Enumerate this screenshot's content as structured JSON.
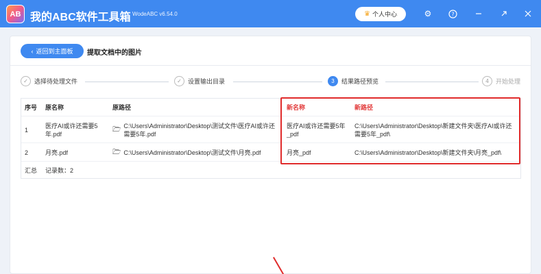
{
  "app": {
    "logo_text": "AB",
    "title": "我的ABC软件工具箱",
    "version": "WodeABC v6.54.0",
    "user_center": "个人中心"
  },
  "icons": {
    "crown": "crown-icon",
    "settings": "gear-icon",
    "help": "help-icon",
    "minimize": "minimize-icon",
    "maximize": "maximize-icon",
    "close": "close-icon",
    "back": "chevron-left-icon",
    "folder": "folder-icon"
  },
  "nav": {
    "back_label": "返回到主面板",
    "page_title": "提取文档中的图片"
  },
  "steps": [
    {
      "label": "选择待处理文件",
      "marker": "✓",
      "state": "done"
    },
    {
      "label": "设置输出目录",
      "marker": "✓",
      "state": "done"
    },
    {
      "label": "结果路径预览",
      "marker": "3",
      "state": "active"
    },
    {
      "label": "开始处理",
      "marker": "4",
      "state": "pending"
    }
  ],
  "table": {
    "headers": {
      "index": "序号",
      "orig_name": "原名称",
      "orig_path": "原路径",
      "new_name": "新名称",
      "new_path": "新路径"
    },
    "rows": [
      {
        "index": "1",
        "orig_name": "医疗AI或许还需要5年.pdf",
        "orig_path": "C:\\Users\\Administrator\\Desktop\\测试文件\\医疗AI或许还需要5年.pdf",
        "new_name": "医疗AI或许还需要5年_pdf",
        "new_path": "C:\\Users\\Administrator\\Desktop\\新建文件夹\\医疗AI或许还需要5年_pdf\\"
      },
      {
        "index": "2",
        "orig_name": "月亮.pdf",
        "orig_path": "C:\\Users\\Administrator\\Desktop\\测试文件\\月亮.pdf",
        "new_name": "月亮_pdf",
        "new_path": "C:\\Users\\Administrator\\Desktop\\新建文件夹\\月亮_pdf\\"
      }
    ],
    "summary_label": "汇总",
    "summary_count": "记录数：2"
  },
  "colors": {
    "primary": "#3f89f0",
    "highlight": "#e02b2b",
    "header_red": "#e23a3a"
  }
}
